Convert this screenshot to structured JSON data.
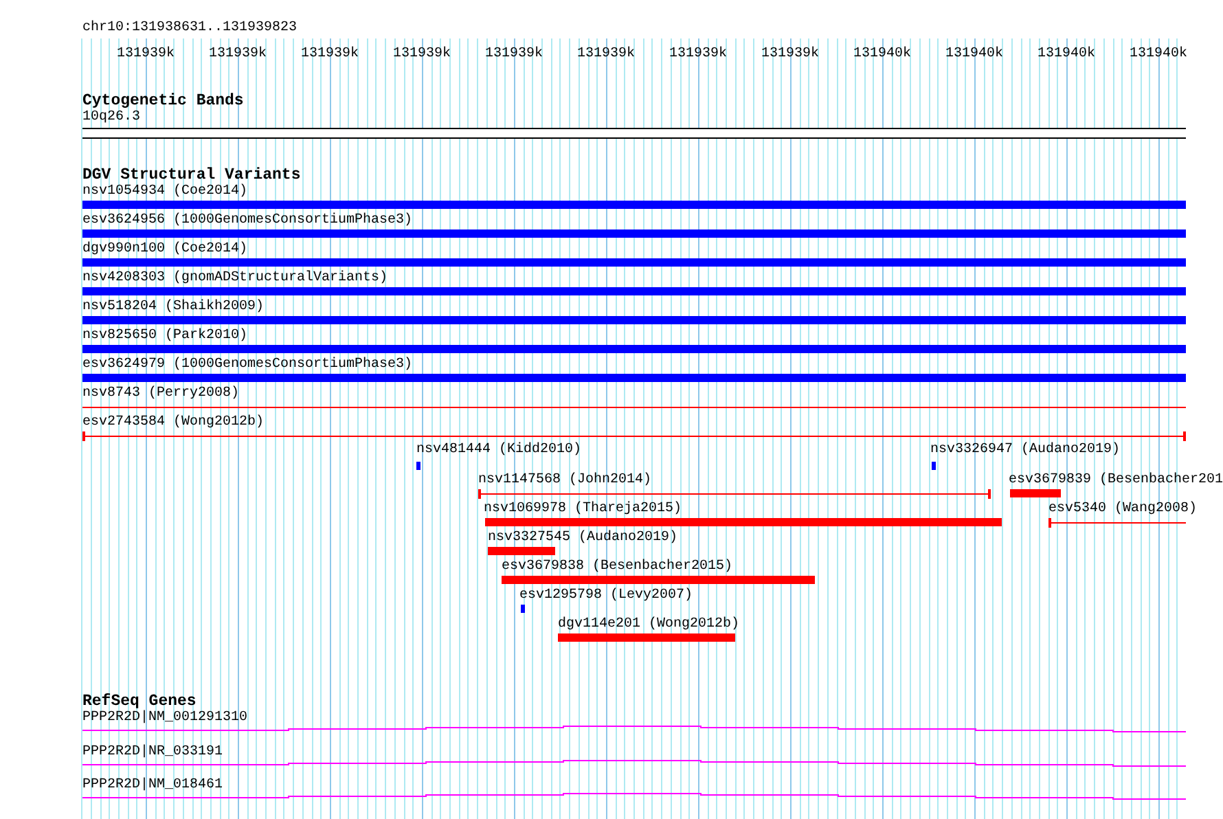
{
  "location": "chr10:131938631..131939823",
  "ruler": {
    "ticks": [
      "131939k",
      "131939k",
      "131939k",
      "131939k",
      "131939k",
      "131939k",
      "131939k",
      "131939k",
      "131940k",
      "131940k",
      "131940k",
      "131940k"
    ]
  },
  "tracks": [
    {
      "kind": "cytoband",
      "title": "Cytogenetic Bands",
      "bands": [
        {
          "label": "10q26.3"
        }
      ]
    },
    {
      "kind": "variants",
      "title": "DGV Structural Variants",
      "features": [
        {
          "label": "nsv1054934 (Coe2014)",
          "kind": "bar",
          "color": "#0000ff"
        },
        {
          "label": "esv3624956 (1000GenomesConsortiumPhase3)",
          "kind": "bar",
          "color": "#0000ff"
        },
        {
          "label": "dgv990n100 (Coe2014)",
          "kind": "bar",
          "color": "#0000ff"
        },
        {
          "label": "nsv4208303 (gnomADStructuralVariants)",
          "kind": "bar",
          "color": "#0000ff"
        },
        {
          "label": "nsv518204 (Shaikh2009)",
          "kind": "bar",
          "color": "#0000ff"
        },
        {
          "label": "nsv825650 (Park2010)",
          "kind": "bar",
          "color": "#0000ff"
        },
        {
          "label": "esv3624979 (1000GenomesConsortiumPhase3)",
          "kind": "bar",
          "color": "#0000ff"
        },
        {
          "label": "nsv8743 (Perry2008)",
          "kind": "line",
          "color": "#ff0000"
        },
        {
          "label": "esv2743584 (Wong2012b)",
          "kind": "line",
          "color": "#ff0000"
        },
        {
          "label": "nsv481444 (Kidd2010)",
          "kind": "bar",
          "color": "#0000ff"
        },
        {
          "label": "nsv3326947 (Audano2019)",
          "kind": "bar",
          "color": "#0000ff"
        },
        {
          "label": "nsv1147568 (John2014)",
          "kind": "line",
          "color": "#ff0000"
        },
        {
          "label": "esv3679839 (Besenbacher201",
          "kind": "bar",
          "color": "#ff0000"
        },
        {
          "label": "nsv1069978 (Thareja2015)",
          "kind": "bar",
          "color": "#ff0000"
        },
        {
          "label": "esv5340 (Wang2008)",
          "kind": "line",
          "color": "#ff0000"
        },
        {
          "label": "nsv3327545 (Audano2019)",
          "kind": "bar",
          "color": "#ff0000"
        },
        {
          "label": "esv3679838 (Besenbacher2015)",
          "kind": "bar",
          "color": "#ff0000"
        },
        {
          "label": "esv1295798 (Levy2007)",
          "kind": "bar",
          "color": "#0000ff"
        },
        {
          "label": "dgv114e201 (Wong2012b)",
          "kind": "bar",
          "color": "#ff0000"
        }
      ]
    },
    {
      "kind": "genes",
      "title": "RefSeq Genes",
      "features": [
        {
          "label": "PPP2R2D|NM_001291310"
        },
        {
          "label": "PPP2R2D|NR_033191"
        },
        {
          "label": "PPP2R2D|NM_018461"
        }
      ]
    }
  ]
}
